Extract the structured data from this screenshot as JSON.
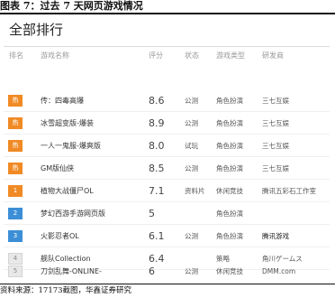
{
  "caption": "图表 7：过去 7 天网页游戏情况",
  "panel": {
    "title": "全部排行",
    "columns": {
      "rank": "排名",
      "name": "游戏名称",
      "score": "评分",
      "status": "状态",
      "type": "游戏类型",
      "developer": "研发商"
    }
  },
  "rows": [
    {
      "rank": "热",
      "name": "传：四毒高爆",
      "score": "8.6",
      "status": "公测",
      "type": "角色扮演",
      "developer": "三七互娱"
    },
    {
      "rank": "热",
      "name": "冰雪超变版-爆装",
      "score": "8.9",
      "status": "公测",
      "type": "角色扮演",
      "developer": "三七互娱"
    },
    {
      "rank": "热",
      "name": "一人一鬼服-爆爽版",
      "score": "8.0",
      "status": "试玩",
      "type": "角色扮演",
      "developer": "三七互娱"
    },
    {
      "rank": "热",
      "name": "GM版仙侠",
      "score": "8.5",
      "status": "公测",
      "type": "角色扮演",
      "developer": "三七互娱"
    },
    {
      "rank": "1",
      "name": "植物大战僵尸OL",
      "score": "7.1",
      "status": "资料片",
      "type": "休闲竞技",
      "developer": "腾讯五彩石工作室"
    },
    {
      "rank": "2",
      "name": "梦幻西游手游网页版",
      "score": "5",
      "status": "",
      "type": "角色扮演",
      "developer": ""
    },
    {
      "rank": "3",
      "name": "火影忍者OL",
      "score": "6.1",
      "status": "公测",
      "type": "角色扮演",
      "developer": "腾讯游戏"
    },
    {
      "rank": "4",
      "name": "舰队Collection",
      "score": "6.4",
      "status": "",
      "type": "策略",
      "developer": "角川ゲームス"
    },
    {
      "rank": "5",
      "name": "刀剑乱舞-ONLINE-",
      "score": "6",
      "status": "公测",
      "type": "休闲竞技",
      "developer": "DMM.com"
    }
  ],
  "source": "资料来源：17173截图，华鑫证券研究"
}
